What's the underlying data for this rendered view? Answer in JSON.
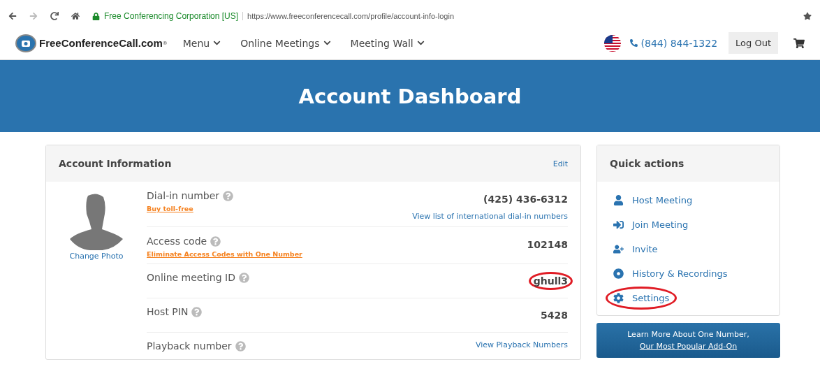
{
  "browser": {
    "site_identity": "Free Conferencing Corporation [US]",
    "url": "https://www.freeconferencecall.com/profile/account-info-login"
  },
  "nav": {
    "logo": "FreeConferenceCall.com",
    "logo_mark": "®",
    "menus": [
      {
        "label": "Menu"
      },
      {
        "label": "Online Meetings"
      },
      {
        "label": "Meeting Wall"
      }
    ],
    "phone": "(844) 844-1322",
    "logout": "Log Out"
  },
  "banner": {
    "title": "Account Dashboard"
  },
  "account": {
    "title": "Account Information",
    "edit": "Edit",
    "change_photo": "Change Photo",
    "rows": [
      {
        "label": "Dial-in number",
        "link": "Buy toll-free",
        "value": "(425) 436-6312",
        "side_link": "View list of international dial-in numbers"
      },
      {
        "label": "Access code",
        "link": "Eliminate Access Codes with One Number",
        "value": "102148"
      },
      {
        "label": "Online meeting ID",
        "value": "ghull3",
        "highlighted": true
      },
      {
        "label": "Host PIN",
        "value": "5428"
      },
      {
        "label": "Playback number",
        "side_link": "View Playback Numbers"
      }
    ]
  },
  "quick_actions": {
    "title": "Quick actions",
    "items": [
      {
        "kind": "host",
        "label": "Host Meeting",
        "highlighted": false
      },
      {
        "kind": "join",
        "label": "Join Meeting",
        "highlighted": false
      },
      {
        "kind": "invite",
        "label": "Invite",
        "highlighted": false
      },
      {
        "kind": "history",
        "label": "History & Recordings",
        "highlighted": false
      },
      {
        "kind": "settings",
        "label": "Settings",
        "highlighted": true
      }
    ]
  },
  "promo": {
    "line1": "Learn More About One Number,",
    "line2": "Our Most Popular Add-On"
  }
}
